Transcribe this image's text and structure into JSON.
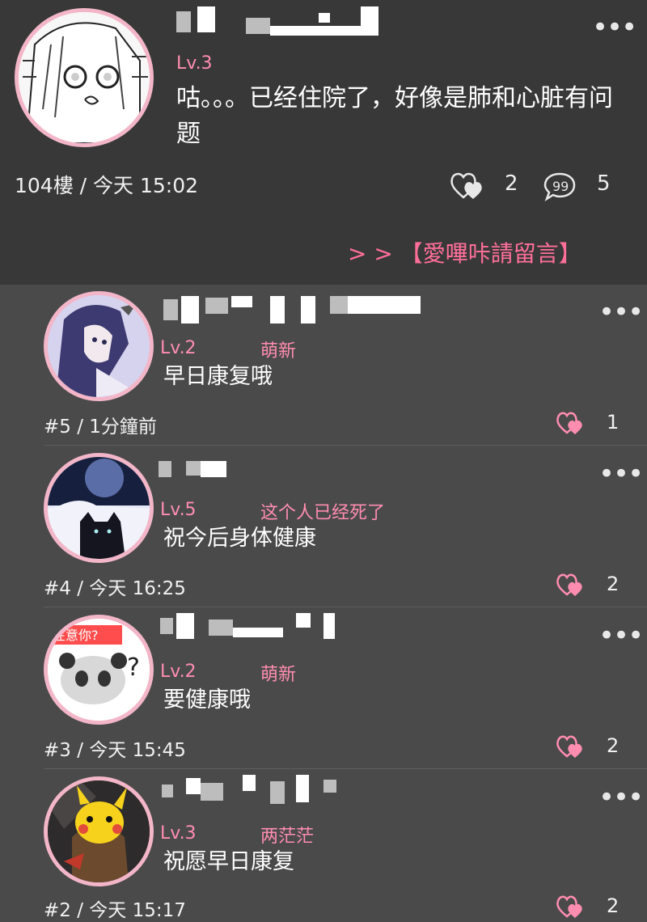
{
  "post": {
    "level": "Lv.3",
    "content": "咕。。。已经住院了，好像是肺和心脏有问题",
    "floor_time": "104樓 / 今天 15:02",
    "likes": "2",
    "comments": "5",
    "link_text": "> > 【愛嗶咔請留言】"
  },
  "replies": [
    {
      "level": "Lv.2",
      "tag": "萌新",
      "content": "早日康复哦",
      "meta": "#5 / 1分鐘前",
      "likes": "1",
      "avatar": "anime-girl"
    },
    {
      "level": "Lv.5",
      "tag": "这个人已经死了",
      "content": "祝今后身体健康",
      "meta": "#4 / 今天 16:25",
      "likes": "2",
      "avatar": "black-cat"
    },
    {
      "level": "Lv.2",
      "tag": "萌新",
      "content": "要健康哦",
      "meta": "#3 / 今天 15:45",
      "likes": "2",
      "avatar": "panda-meme",
      "avatar_text": "在意你?"
    },
    {
      "level": "Lv.3",
      "tag": "两茫茫",
      "content": "祝愿早日康复",
      "meta": "#2 / 今天 15:17",
      "likes": "2",
      "avatar": "pikachu"
    }
  ],
  "colors": {
    "accent": "#ff8db0",
    "avatar_border": "#f3b6c8",
    "post_bg": "#383839",
    "list_bg": "#4a4a4b"
  }
}
